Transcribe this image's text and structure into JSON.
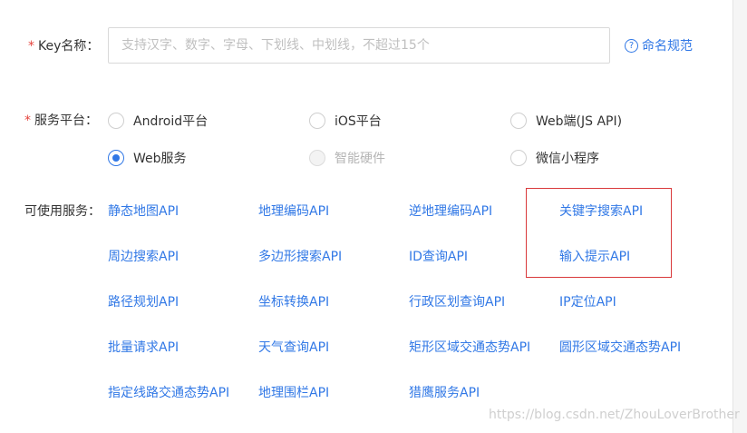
{
  "form": {
    "required_mark": "*",
    "key_label": "Key名称：",
    "key_placeholder": "支持汉字、数字、字母、下划线、中划线，不超过15个",
    "key_value": "",
    "naming_help_icon": "?",
    "naming_link": "命名规范",
    "platform_label": "服务平台：",
    "platforms": [
      {
        "label": "Android平台",
        "checked": false,
        "disabled": false
      },
      {
        "label": "iOS平台",
        "checked": false,
        "disabled": false
      },
      {
        "label": "Web端(JS API)",
        "checked": false,
        "disabled": false
      },
      {
        "label": "Web服务",
        "checked": true,
        "disabled": false
      },
      {
        "label": "智能硬件",
        "checked": false,
        "disabled": true
      },
      {
        "label": "微信小程序",
        "checked": false,
        "disabled": false
      }
    ],
    "services_label": "可使用服务：",
    "services": [
      "静态地图API",
      "地理编码API",
      "逆地理编码API",
      "关键字搜索API",
      "周边搜索API",
      "多边形搜索API",
      "ID查询API",
      "输入提示API",
      "路径规划API",
      "坐标转换API",
      "行政区划查询API",
      "IP定位API",
      "批量请求API",
      "天气查询API",
      "矩形区域交通态势API",
      "圆形区域交通态势API",
      "指定线路交通态势API",
      "地理围栏API",
      "猎鹰服务API"
    ]
  },
  "watermark": "https://blog.csdn.net/ZhouLoverBrother",
  "colors": {
    "link": "#3178e6",
    "required": "#e5433d",
    "highlight_border": "#d9393b",
    "disabled_text": "#b5b5b5"
  }
}
